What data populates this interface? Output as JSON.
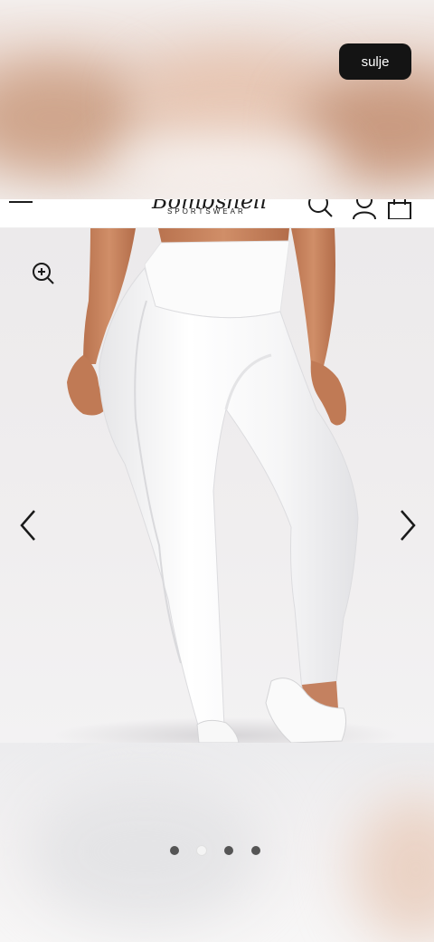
{
  "overlay": {
    "close_label": "sulje"
  },
  "header": {
    "logo_script": "Bombshell",
    "logo_sub": "SPORTSWEAR",
    "icons": [
      "menu-icon",
      "search-icon",
      "account-icon",
      "bag-icon"
    ]
  },
  "gallery": {
    "zoom_icon": "zoom-in-icon",
    "prev_icon": "chevron-left-icon",
    "next_icon": "chevron-right-icon",
    "slides_total": 4,
    "active_slide": 2
  },
  "colors": {
    "close_bg": "#141414",
    "dot_inactive": "#555555",
    "dot_active": "#f4f4f4"
  }
}
